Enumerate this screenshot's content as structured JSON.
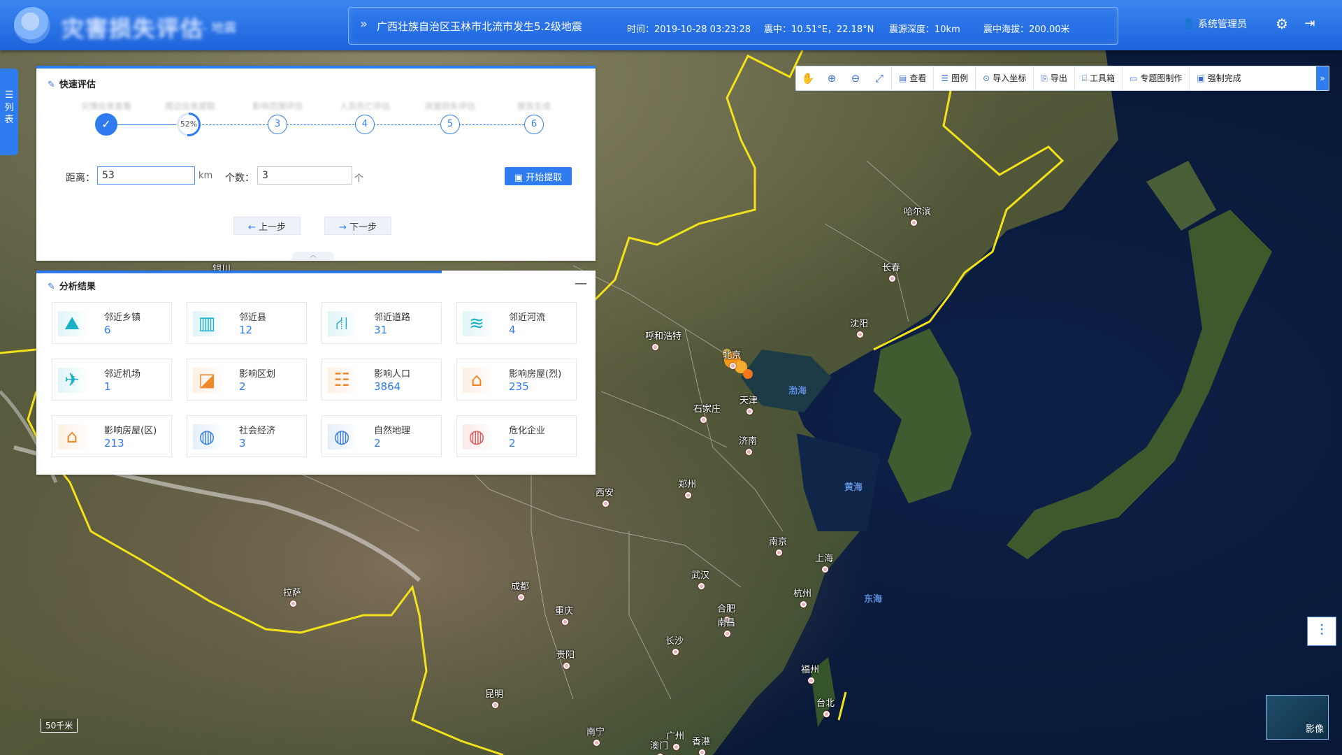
{
  "header": {
    "app_title": "灾害损失评估",
    "app_subtitle": "- 地震",
    "quake_title": "广西壮族自治区玉林市北流市发生5.2级地震",
    "time": "时间：2019-10-28  03:23:28",
    "epicenter": "震中：10.51°E，22.18°N",
    "depth": "震源深度：10km",
    "altitude": "震中海拔：200.00米",
    "user": "系统管理员"
  },
  "side_tab": {
    "label": "列表"
  },
  "toolbar": {
    "buttons": [
      "查看",
      "图例",
      "导入坐标",
      "导出",
      "工具箱",
      "专题图制作",
      "强制完成"
    ]
  },
  "quick_panel": {
    "title": "快速评估",
    "steps": [
      {
        "label": "灾情信息查看",
        "state": "done"
      },
      {
        "label": "周边信息提取",
        "state": "progress",
        "progress": "52%"
      },
      {
        "label": "影响范围评估",
        "state": "todo",
        "number": "3"
      },
      {
        "label": "人员伤亡评估",
        "state": "todo",
        "number": "4"
      },
      {
        "label": "房屋损失评估",
        "state": "todo",
        "number": "5"
      },
      {
        "label": "报告生成",
        "state": "todo",
        "number": "6"
      }
    ],
    "distance_label": "距离：",
    "distance_value": "53",
    "distance_unit": "km",
    "count_label": "个数：",
    "count_value": "3",
    "count_unit": "个",
    "extract_button": "开始提取",
    "prev_button": "上一步",
    "next_button": "下一步"
  },
  "result_panel": {
    "title": "分析结果",
    "cards": [
      {
        "name": "邻近乡镇",
        "value": "6",
        "icon": "town-icon",
        "color": "#1ab0c8"
      },
      {
        "name": "邻近县",
        "value": "12",
        "icon": "building-icon",
        "color": "#1ab0c8"
      },
      {
        "name": "邻近道路",
        "value": "31",
        "icon": "road-icon",
        "color": "#1ab0c8"
      },
      {
        "name": "邻近河流",
        "value": "4",
        "icon": "river-icon",
        "color": "#1ab0c8"
      },
      {
        "name": "邻近机场",
        "value": "1",
        "icon": "airport-icon",
        "color": "#1ab0c8"
      },
      {
        "name": "影响区划",
        "value": "2",
        "icon": "region-map-icon",
        "color": "#f0892b"
      },
      {
        "name": "影响人口",
        "value": "3864",
        "icon": "population-icon",
        "color": "#f0892b"
      },
      {
        "name": "影响房屋(烈)",
        "value": "235",
        "icon": "house-damage-icon",
        "color": "#f0892b"
      },
      {
        "name": "影响房屋(区)",
        "value": "213",
        "icon": "house-icon",
        "color": "#f0892b"
      },
      {
        "name": "社会经济",
        "value": "3",
        "icon": "globe-economy-icon",
        "color": "#3b7fd8"
      },
      {
        "name": "自然地理",
        "value": "2",
        "icon": "globe-geography-icon",
        "color": "#3b7fd8"
      },
      {
        "name": "危化企业",
        "value": "2",
        "icon": "globe-hazard-icon",
        "color": "#e15a5a"
      }
    ]
  },
  "map": {
    "cities": [
      "哈尔滨",
      "长春",
      "沈阳",
      "呼和浩特",
      "北京",
      "天津",
      "石家庄",
      "济南",
      "郑州",
      "西安",
      "南京",
      "上海",
      "武汉",
      "合肥",
      "杭州",
      "成都",
      "重庆",
      "长沙",
      "南昌",
      "贵阳",
      "昆明",
      "福州",
      "台北",
      "广州",
      "南宁",
      "香港",
      "澳门",
      "拉萨",
      "银川"
    ],
    "seas": [
      "渤海",
      "黄海",
      "东海"
    ],
    "scale": "50千米",
    "image_toggle": "影像"
  }
}
